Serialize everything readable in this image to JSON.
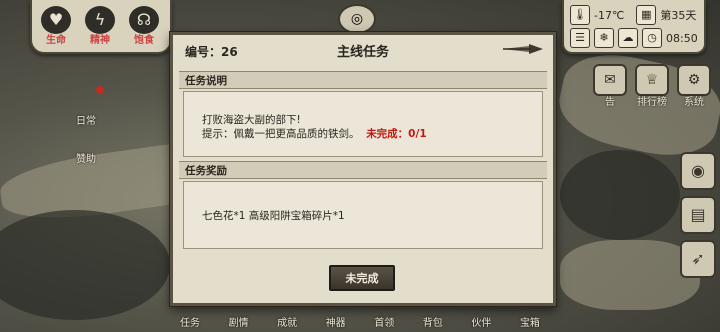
{
  "status_icons": [
    {
      "label": "生命",
      "icon": "heart-head-icon"
    },
    {
      "label": "精神",
      "icon": "lightning-head-icon"
    },
    {
      "label": "饱食",
      "icon": "stomach-head-icon"
    }
  ],
  "hud": {
    "temperature": "-17℃",
    "day": "第35天",
    "time": "08:50"
  },
  "side_buttons": [
    {
      "label": "告"
    },
    {
      "label": "排行榜"
    },
    {
      "label": "系统"
    }
  ],
  "map_labels": {
    "daily": "日常",
    "support": "赞助"
  },
  "dialog": {
    "id_label": "编号：",
    "id_value": "26",
    "title": "主线任务",
    "description_header": "任务说明",
    "description_line1": "打败海盗大副的部下!",
    "description_line2_prefix": "提示：佩戴一把更高品质的铁剑。",
    "description_status": "未完成：0/1",
    "reward_header": "任务奖励",
    "reward_text": "七色花*1  高级阳阱宝箱碎片*1",
    "button_label": "未完成"
  },
  "bottom_menu": [
    "任务",
    "剧情",
    "成就",
    "神器",
    "首领",
    "背包",
    "伙伴",
    "宝箱"
  ]
}
